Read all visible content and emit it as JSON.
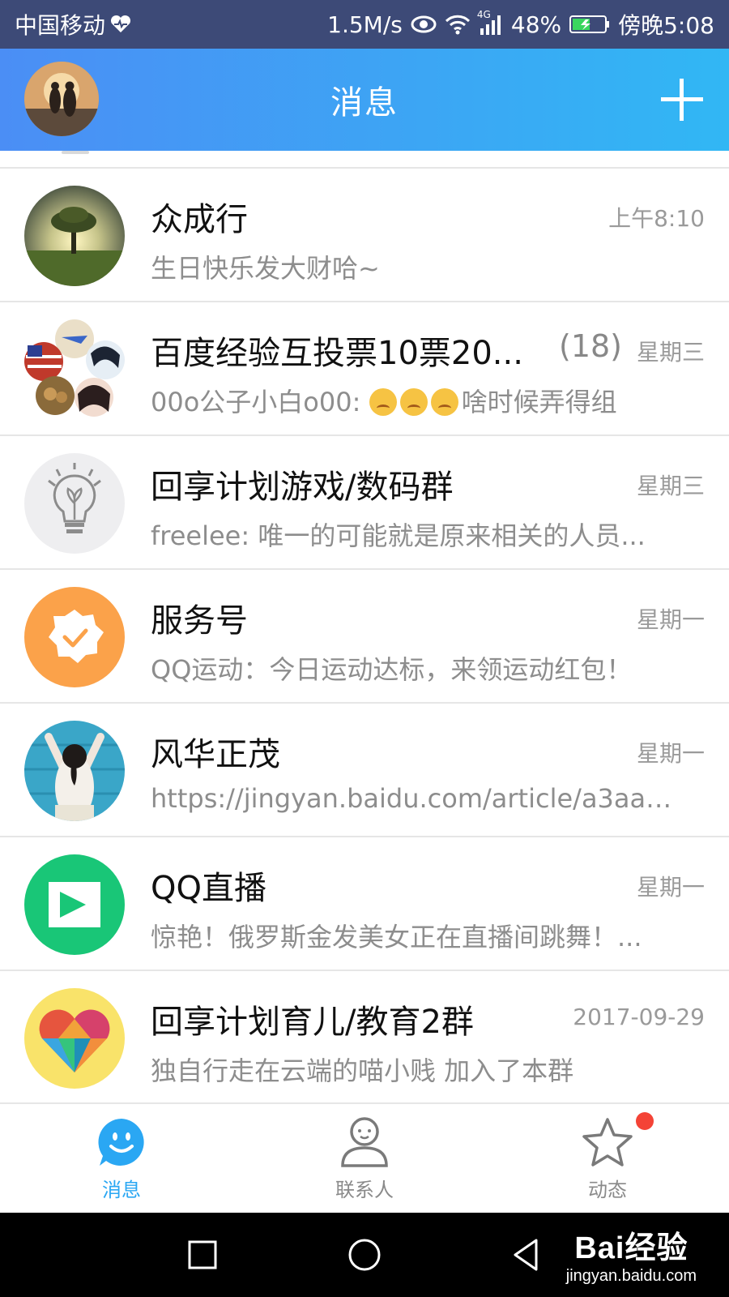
{
  "status_bar": {
    "carrier": "中国移动",
    "speed": "1.5M/s",
    "network": "4G",
    "battery": "48%",
    "time": "傍晚5:08"
  },
  "header": {
    "title": "消息"
  },
  "conversations": [
    {
      "name": "众成行",
      "time": "上午8:10",
      "preview": "生日快乐发大财哈~",
      "avatar": "tree-avatar"
    },
    {
      "name": "百度经验互投票10票20...",
      "count": "(18)",
      "time": "星期三",
      "preview_prefix": "00o公子小白o00: ",
      "preview_suffix": "啥时候弄得组",
      "avatar": "group-avatar"
    },
    {
      "name": "回享计划游戏/数码群",
      "time": "星期三",
      "preview": "freelee: 唯一的可能就是原来相关的人员...",
      "avatar": "lightbulb-avatar"
    },
    {
      "name": "服务号",
      "time": "星期一",
      "preview": "QQ运动：今日运动达标，来领运动红包！",
      "avatar": "service-avatar"
    },
    {
      "name": "风华正茂",
      "time": "星期一",
      "preview": "https://jingyan.baidu.com/article/a3aad...",
      "avatar": "girl-avatar"
    },
    {
      "name": "QQ直播",
      "time": "星期一",
      "preview": "惊艳！俄罗斯金发美女正在直播间跳舞！...",
      "avatar": "live-avatar"
    },
    {
      "name": "回享计划育儿/教育2群",
      "time": "2017-09-29",
      "preview": "独自行走在云端的喵小贱 加入了本群",
      "avatar": "heart-avatar"
    }
  ],
  "tabs": [
    {
      "label": "消息",
      "active": true
    },
    {
      "label": "联系人",
      "active": false
    },
    {
      "label": "动态",
      "active": false
    }
  ],
  "watermark": {
    "brand": "Bai经验",
    "url": "jingyan.baidu.com"
  },
  "colors": {
    "accent": "#2aa7f3",
    "header_start": "#4b8ef5",
    "header_end": "#31b7f4",
    "badge": "#f44336"
  }
}
